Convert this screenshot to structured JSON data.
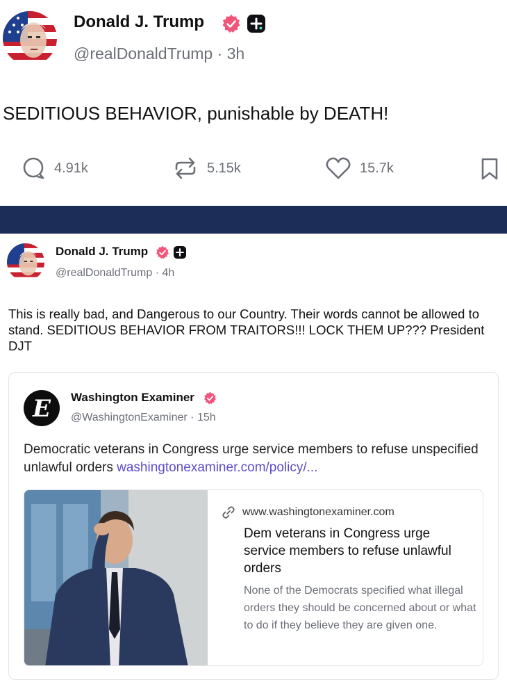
{
  "post_main": {
    "author_name": "Donald J. Trump",
    "handle_time": "@realDonaldTrump · 3h",
    "text": "SEDITIOUS BEHAVIOR, punishable by DEATH!",
    "replies": "4.91k",
    "retruths": "5.15k",
    "likes": "15.7k"
  },
  "post_original": {
    "author_name": "Donald J. Trump",
    "handle_time": "@realDonaldTrump · 4h",
    "text": "This is really bad, and Dangerous to our Country. Their words cannot be allowed to stand. SEDITIOUS BEHAVIOR FROM TRAITORS!!! LOCK THEM UP??? President DJT"
  },
  "quote": {
    "author_name": "Washington Examiner",
    "handle_time": "@WashingtonExaminer · 15h",
    "text": "Democratic veterans in Congress urge service members to refuse unspecified unlawful orders",
    "link_text": "washingtonexaminer.com/policy/...",
    "card": {
      "domain": "www.washingtonexaminer.com",
      "title": "Dem veterans in Congress urge service members to refuse unlawful orders",
      "description": "None of the Democrats specified what illegal orders they should be concerned about or what to do if they believe they are given one."
    }
  },
  "icons": {
    "verified": "verified-badge-icon",
    "plus": "plus-badge-icon",
    "reply": "reply-bubble-icon",
    "retruth": "retruth-arrows-icon",
    "like": "heart-icon",
    "bookmark": "bookmark-icon",
    "link": "link-chain-icon"
  },
  "colors": {
    "verified_badge": "#f2557a",
    "divider_band": "#1c2d58",
    "link": "#5a4ec9",
    "muted_text": "#6b6f76"
  }
}
